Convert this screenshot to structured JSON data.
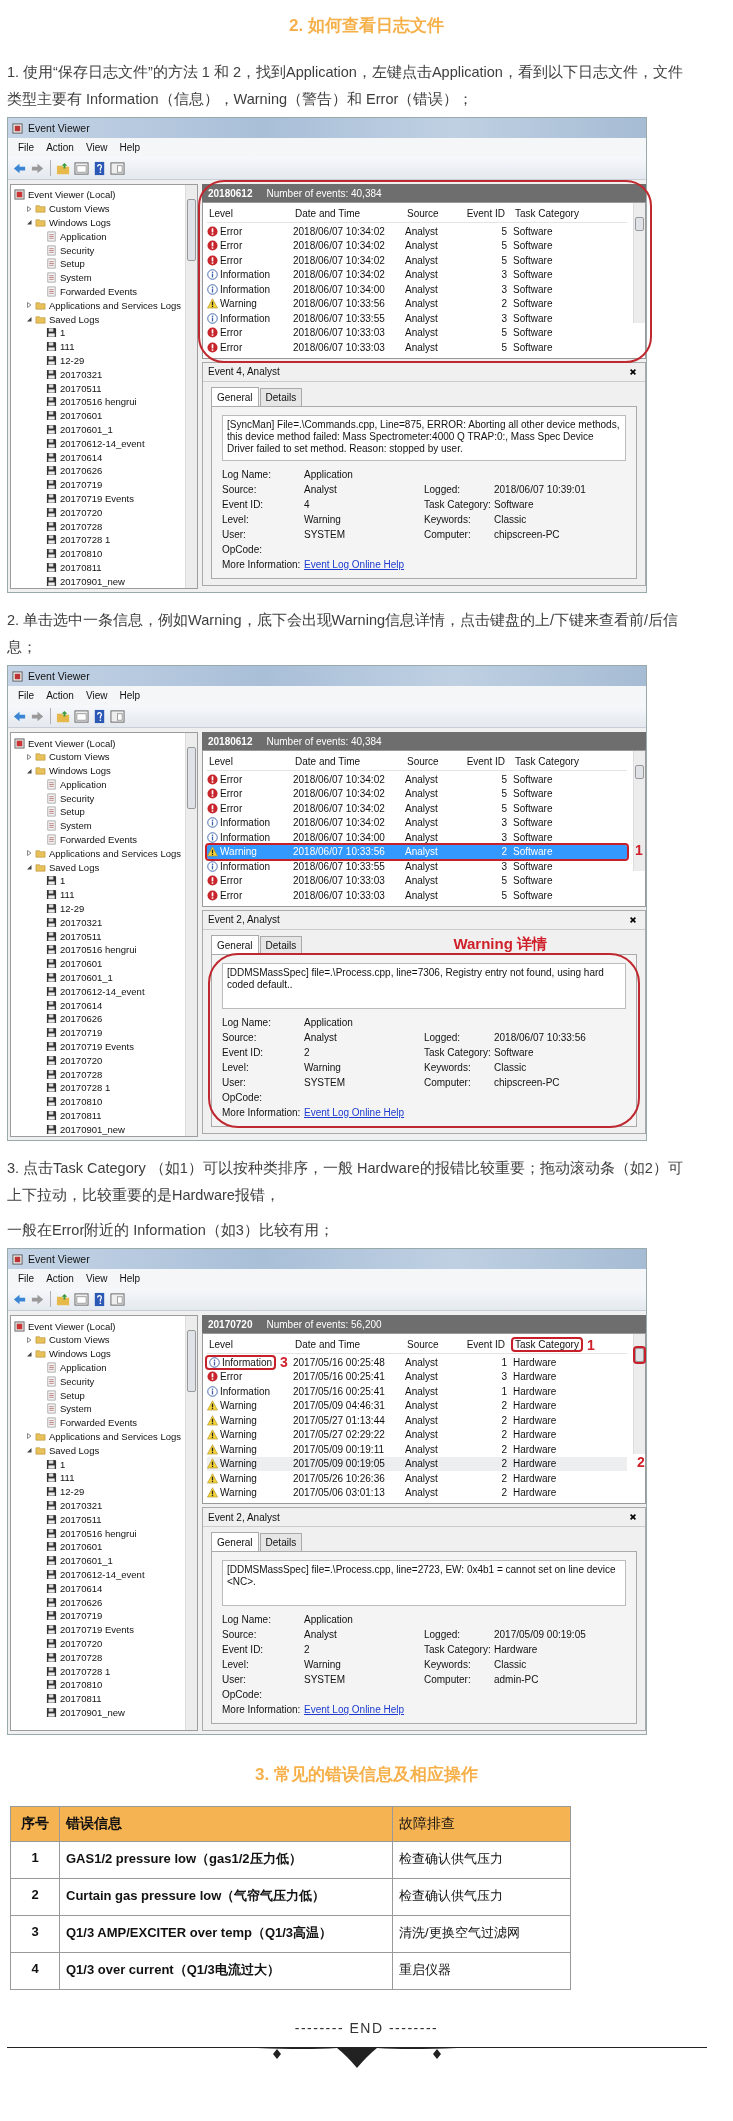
{
  "content": [
    {
      "kind": "heading",
      "text": "2. 如何查看日志文件"
    },
    {
      "kind": "paragraph",
      "text": "1. 使用“保存日志文件”的方法 1 和 2，找到Application，左键点击Application，看到以下日志文件，文件类型主要有 Information（信息），Warning（警告）和 Error（错误）；"
    },
    {
      "kind": "screenshot",
      "title": "Event Viewer",
      "menu": [
        "File",
        "Action",
        "View",
        "Help"
      ],
      "tree": [
        {
          "label": "Event Viewer (Local)",
          "kind": "viewer",
          "children": [
            {
              "label": "Custom Views",
              "kind": "folder",
              "expanded": false
            },
            {
              "label": "Windows Logs",
              "kind": "folder",
              "expanded": true,
              "children": [
                {
                  "label": "Application",
                  "kind": "log"
                },
                {
                  "label": "Security",
                  "kind": "log"
                },
                {
                  "label": "Setup",
                  "kind": "log"
                },
                {
                  "label": "System",
                  "kind": "log"
                },
                {
                  "label": "Forwarded Events",
                  "kind": "log"
                }
              ]
            },
            {
              "label": "Applications and Services Logs",
              "kind": "folder",
              "expanded": false
            },
            {
              "label": "Saved Logs",
              "kind": "folder",
              "expanded": true,
              "children": [
                {
                  "label": "1",
                  "kind": "saved"
                },
                {
                  "label": "111",
                  "kind": "saved"
                },
                {
                  "label": "12-29",
                  "kind": "saved"
                },
                {
                  "label": "20170321",
                  "kind": "saved"
                },
                {
                  "label": "20170511",
                  "kind": "saved"
                },
                {
                  "label": "20170516 hengrui",
                  "kind": "saved"
                },
                {
                  "label": "20170601",
                  "kind": "saved"
                },
                {
                  "label": "20170601_1",
                  "kind": "saved"
                },
                {
                  "label": "20170612-14_event",
                  "kind": "saved"
                },
                {
                  "label": "20170614",
                  "kind": "saved"
                },
                {
                  "label": "20170626",
                  "kind": "saved"
                },
                {
                  "label": "20170719",
                  "kind": "saved"
                },
                {
                  "label": "20170719 Events",
                  "kind": "saved"
                },
                {
                  "label": "20170720",
                  "kind": "saved"
                },
                {
                  "label": "20170728",
                  "kind": "saved"
                },
                {
                  "label": "20170728 1",
                  "kind": "saved"
                },
                {
                  "label": "20170810",
                  "kind": "saved"
                },
                {
                  "label": "20170811",
                  "kind": "saved"
                },
                {
                  "label": "20170901_new",
                  "kind": "saved"
                }
              ]
            }
          ]
        }
      ],
      "log_name": "20180612",
      "event_count": "Number of events: 40,384",
      "list_circled": true,
      "columns": [
        {
          "label": "Level"
        },
        {
          "label": "Date and Time"
        },
        {
          "label": "Source"
        },
        {
          "label": "Event ID"
        },
        {
          "label": "Task Category"
        }
      ],
      "rows": [
        {
          "kind": "error",
          "level": "Error",
          "date": "2018/06/07 10:34:02",
          "source": "Analyst",
          "event_id": "5",
          "category": "Software",
          "selected": false
        },
        {
          "kind": "error",
          "level": "Error",
          "date": "2018/06/07 10:34:02",
          "source": "Analyst",
          "event_id": "5",
          "category": "Software",
          "selected": false
        },
        {
          "kind": "error",
          "level": "Error",
          "date": "2018/06/07 10:34:02",
          "source": "Analyst",
          "event_id": "5",
          "category": "Software",
          "selected": false
        },
        {
          "kind": "information",
          "level": "Information",
          "date": "2018/06/07 10:34:02",
          "source": "Analyst",
          "event_id": "3",
          "category": "Software",
          "selected": false
        },
        {
          "kind": "information",
          "level": "Information",
          "date": "2018/06/07 10:34:00",
          "source": "Analyst",
          "event_id": "3",
          "category": "Software",
          "selected": false
        },
        {
          "kind": "warning",
          "level": "Warning",
          "date": "2018/06/07 10:33:56",
          "source": "Analyst",
          "event_id": "2",
          "category": "Software",
          "selected": false
        },
        {
          "kind": "information",
          "level": "Information",
          "date": "2018/06/07 10:33:55",
          "source": "Analyst",
          "event_id": "3",
          "category": "Software",
          "selected": false
        },
        {
          "kind": "error",
          "level": "Error",
          "date": "2018/06/07 10:33:03",
          "source": "Analyst",
          "event_id": "5",
          "category": "Software",
          "selected": false
        },
        {
          "kind": "error",
          "level": "Error",
          "date": "2018/06/07 10:33:03",
          "source": "Analyst",
          "event_id": "5",
          "category": "Software",
          "selected": false
        }
      ],
      "details": {
        "title": "Event 4, Analyst",
        "tabs": [
          {
            "label": "General",
            "selected": true
          },
          {
            "label": "Details",
            "selected": false
          }
        ],
        "message": "[SyncMan] File=.\\Commands.cpp, Line=875, ERROR: Aborting all other device methods, this device method failed: Mass Spectrometer:4000 Q TRAP:0:, Mass Spec Device Driver failed to set method.  Reason:  stopped by user.",
        "properties": [
          {
            "label": "Log Name:",
            "value": "Application"
          },
          {
            "label": "Source:",
            "value": "Analyst",
            "label2": "Logged:",
            "value2": "2018/06/07 10:39:01"
          },
          {
            "label": "Event ID:",
            "value": "4",
            "label2": "Task Category:",
            "value2": "Software"
          },
          {
            "label": "Level:",
            "value": "Warning",
            "label2": "Keywords:",
            "value2": "Classic"
          },
          {
            "label": "User:",
            "value": "SYSTEM",
            "label2": "Computer:",
            "value2": "chipscreen-PC"
          },
          {
            "label": "OpCode:"
          },
          {
            "label": "More Information:",
            "link": "Event Log Online Help"
          }
        ]
      }
    },
    {
      "kind": "paragraph",
      "text": "2. 单击选中一条信息，例如Warning，底下会出现Warning信息详情，点击键盘的上/下键来查看前/后信息；"
    },
    {
      "kind": "screenshot",
      "title": "Event Viewer",
      "menu": [
        "File",
        "Action",
        "View",
        "Help"
      ],
      "tree": [
        {
          "label": "Event Viewer (Local)",
          "kind": "viewer",
          "children": [
            {
              "label": "Custom Views",
              "kind": "folder",
              "expanded": false
            },
            {
              "label": "Windows Logs",
              "kind": "folder",
              "expanded": true,
              "children": [
                {
                  "label": "Application",
                  "kind": "log"
                },
                {
                  "label": "Security",
                  "kind": "log"
                },
                {
                  "label": "Setup",
                  "kind": "log"
                },
                {
                  "label": "System",
                  "kind": "log"
                },
                {
                  "label": "Forwarded Events",
                  "kind": "log"
                }
              ]
            },
            {
              "label": "Applications and Services Logs",
              "kind": "folder",
              "expanded": false
            },
            {
              "label": "Saved Logs",
              "kind": "folder",
              "expanded": true,
              "children": [
                {
                  "label": "1",
                  "kind": "saved"
                },
                {
                  "label": "111",
                  "kind": "saved"
                },
                {
                  "label": "12-29",
                  "kind": "saved"
                },
                {
                  "label": "20170321",
                  "kind": "saved"
                },
                {
                  "label": "20170511",
                  "kind": "saved"
                },
                {
                  "label": "20170516 hengrui",
                  "kind": "saved"
                },
                {
                  "label": "20170601",
                  "kind": "saved"
                },
                {
                  "label": "20170601_1",
                  "kind": "saved"
                },
                {
                  "label": "20170612-14_event",
                  "kind": "saved"
                },
                {
                  "label": "20170614",
                  "kind": "saved"
                },
                {
                  "label": "20170626",
                  "kind": "saved"
                },
                {
                  "label": "20170719",
                  "kind": "saved"
                },
                {
                  "label": "20170719 Events",
                  "kind": "saved"
                },
                {
                  "label": "20170720",
                  "kind": "saved"
                },
                {
                  "label": "20170728",
                  "kind": "saved"
                },
                {
                  "label": "20170728 1",
                  "kind": "saved"
                },
                {
                  "label": "20170810",
                  "kind": "saved"
                },
                {
                  "label": "20170811",
                  "kind": "saved"
                },
                {
                  "label": "20170901_new",
                  "kind": "saved"
                }
              ]
            }
          ]
        }
      ],
      "log_name": "20180612",
      "event_count": "Number of events: 40,384",
      "list_focused": true,
      "columns": [
        {
          "label": "Level"
        },
        {
          "label": "Date and Time"
        },
        {
          "label": "Source"
        },
        {
          "label": "Event ID"
        },
        {
          "label": "Task Category"
        }
      ],
      "rows": [
        {
          "kind": "error",
          "level": "Error",
          "date": "2018/06/07 10:34:02",
          "source": "Analyst",
          "event_id": "5",
          "category": "Software",
          "selected": false
        },
        {
          "kind": "error",
          "level": "Error",
          "date": "2018/06/07 10:34:02",
          "source": "Analyst",
          "event_id": "5",
          "category": "Software",
          "selected": false
        },
        {
          "kind": "error",
          "level": "Error",
          "date": "2018/06/07 10:34:02",
          "source": "Analyst",
          "event_id": "5",
          "category": "Software",
          "selected": false
        },
        {
          "kind": "information",
          "level": "Information",
          "date": "2018/06/07 10:34:02",
          "source": "Analyst",
          "event_id": "3",
          "category": "Software",
          "selected": false
        },
        {
          "kind": "information",
          "level": "Information",
          "date": "2018/06/07 10:34:00",
          "source": "Analyst",
          "event_id": "3",
          "category": "Software",
          "selected": false
        },
        {
          "kind": "warning",
          "level": "Warning",
          "date": "2018/06/07 10:33:56",
          "source": "Analyst",
          "event_id": "2",
          "category": "Software",
          "selected": true,
          "callout": {
            "label": "1",
            "kind": "row"
          }
        },
        {
          "kind": "information",
          "level": "Information",
          "date": "2018/06/07 10:33:55",
          "source": "Analyst",
          "event_id": "3",
          "category": "Software",
          "selected": false
        },
        {
          "kind": "error",
          "level": "Error",
          "date": "2018/06/07 10:33:03",
          "source": "Analyst",
          "event_id": "5",
          "category": "Software",
          "selected": false
        },
        {
          "kind": "error",
          "level": "Error",
          "date": "2018/06/07 10:33:03",
          "source": "Analyst",
          "event_id": "5",
          "category": "Software",
          "selected": false
        }
      ],
      "details": {
        "title": "Event 2, Analyst",
        "circled": true,
        "callout_title": "Warning 详情",
        "tabs": [
          {
            "label": "General",
            "selected": true
          },
          {
            "label": "Details",
            "selected": false
          }
        ],
        "message": "[DDMSMassSpec] file=.\\Process.cpp, line=7306, Registry entry not found, using hard coded default..",
        "properties": [
          {
            "label": "Log Name:",
            "value": "Application"
          },
          {
            "label": "Source:",
            "value": "Analyst",
            "label2": "Logged:",
            "value2": "2018/06/07 10:33:56"
          },
          {
            "label": "Event ID:",
            "value": "2",
            "label2": "Task Category:",
            "value2": "Software"
          },
          {
            "label": "Level:",
            "value": "Warning",
            "label2": "Keywords:",
            "value2": "Classic"
          },
          {
            "label": "User:",
            "value": "SYSTEM",
            "label2": "Computer:",
            "value2": "chipscreen-PC"
          },
          {
            "label": "OpCode:"
          },
          {
            "label": "More Information:",
            "link": "Event Log Online Help"
          }
        ]
      }
    },
    {
      "kind": "paragraph",
      "text": "3. 点击Task Category （如1）可以按种类排序，一般 Hardware的报错比较重要；拖动滚动条（如2）可上下拉动，比较重要的是Hardware报错，"
    },
    {
      "kind": "paragraph",
      "text": "一般在Error附近的 Information（如3）比较有用；"
    },
    {
      "kind": "screenshot",
      "title": "Event Viewer",
      "menu": [
        "File",
        "Action",
        "View",
        "Help"
      ],
      "tree": [
        {
          "label": "Event Viewer (Local)",
          "kind": "viewer",
          "children": [
            {
              "label": "Custom Views",
              "kind": "folder",
              "expanded": false
            },
            {
              "label": "Windows Logs",
              "kind": "folder",
              "expanded": true,
              "children": [
                {
                  "label": "Application",
                  "kind": "log"
                },
                {
                  "label": "Security",
                  "kind": "log"
                },
                {
                  "label": "Setup",
                  "kind": "log"
                },
                {
                  "label": "System",
                  "kind": "log"
                },
                {
                  "label": "Forwarded Events",
                  "kind": "log"
                }
              ]
            },
            {
              "label": "Applications and Services Logs",
              "kind": "folder",
              "expanded": false
            },
            {
              "label": "Saved Logs",
              "kind": "folder",
              "expanded": true,
              "children": [
                {
                  "label": "1",
                  "kind": "saved"
                },
                {
                  "label": "111",
                  "kind": "saved"
                },
                {
                  "label": "12-29",
                  "kind": "saved"
                },
                {
                  "label": "20170321",
                  "kind": "saved"
                },
                {
                  "label": "20170511",
                  "kind": "saved"
                },
                {
                  "label": "20170516 hengrui",
                  "kind": "saved"
                },
                {
                  "label": "20170601",
                  "kind": "saved"
                },
                {
                  "label": "20170601_1",
                  "kind": "saved"
                },
                {
                  "label": "20170612-14_event",
                  "kind": "saved"
                },
                {
                  "label": "20170614",
                  "kind": "saved"
                },
                {
                  "label": "20170626",
                  "kind": "saved"
                },
                {
                  "label": "20170719",
                  "kind": "saved"
                },
                {
                  "label": "20170719 Events",
                  "kind": "saved"
                },
                {
                  "label": "20170720",
                  "kind": "saved"
                },
                {
                  "label": "20170728",
                  "kind": "saved"
                },
                {
                  "label": "20170728 1",
                  "kind": "saved"
                },
                {
                  "label": "20170810",
                  "kind": "saved"
                },
                {
                  "label": "20170811",
                  "kind": "saved"
                },
                {
                  "label": "20170901_new",
                  "kind": "saved"
                }
              ]
            }
          ]
        }
      ],
      "log_name": "20170720",
      "event_count": "Number of events: 56,200",
      "list_focused": false,
      "scrollbar_callout": "2",
      "columns": [
        {
          "label": "Level"
        },
        {
          "label": "Date and Time"
        },
        {
          "label": "Source"
        },
        {
          "label": "Event ID"
        },
        {
          "label": "Task Category",
          "callout": "1"
        }
      ],
      "rows": [
        {
          "kind": "information",
          "level": "Information",
          "date": "2017/05/16 00:25:48",
          "source": "Analyst",
          "event_id": "1",
          "category": "Hardware",
          "selected": false,
          "callout": {
            "label": "3",
            "kind": "level"
          }
        },
        {
          "kind": "error",
          "level": "Error",
          "date": "2017/05/16 00:25:41",
          "source": "Analyst",
          "event_id": "3",
          "category": "Hardware",
          "selected": false
        },
        {
          "kind": "information",
          "level": "Information",
          "date": "2017/05/16 00:25:41",
          "source": "Analyst",
          "event_id": "1",
          "category": "Hardware",
          "selected": false
        },
        {
          "kind": "warning",
          "level": "Warning",
          "date": "2017/05/09 04:46:31",
          "source": "Analyst",
          "event_id": "2",
          "category": "Hardware",
          "selected": false
        },
        {
          "kind": "warning",
          "level": "Warning",
          "date": "2017/05/27 01:13:44",
          "source": "Analyst",
          "event_id": "2",
          "category": "Hardware",
          "selected": false
        },
        {
          "kind": "warning",
          "level": "Warning",
          "date": "2017/05/27 02:29:22",
          "source": "Analyst",
          "event_id": "2",
          "category": "Hardware",
          "selected": false
        },
        {
          "kind": "warning",
          "level": "Warning",
          "date": "2017/05/09 00:19:11",
          "source": "Analyst",
          "event_id": "2",
          "category": "Hardware",
          "selected": false
        },
        {
          "kind": "warning",
          "level": "Warning",
          "date": "2017/05/09 00:19:05",
          "source": "Analyst",
          "event_id": "2",
          "category": "Hardware",
          "selected": true
        },
        {
          "kind": "warning",
          "level": "Warning",
          "date": "2017/05/26 10:26:36",
          "source": "Analyst",
          "event_id": "2",
          "category": "Hardware",
          "selected": false
        },
        {
          "kind": "warning",
          "level": "Warning",
          "date": "2017/05/06 03:01:13",
          "source": "Analyst",
          "event_id": "2",
          "category": "Hardware",
          "selected": false
        }
      ],
      "details": {
        "title": "Event 2, Analyst",
        "tabs": [
          {
            "label": "General",
            "selected": true
          },
          {
            "label": "Details",
            "selected": false
          }
        ],
        "message": "[DDMSMassSpec] file=.\\Process.cpp, line=2723, EW: 0x4b1 = cannot set on line device <NC>.",
        "properties": [
          {
            "label": "Log Name:",
            "value": "Application"
          },
          {
            "label": "Source:",
            "value": "Analyst",
            "label2": "Logged:",
            "value2": "2017/05/09 00:19:05"
          },
          {
            "label": "Event ID:",
            "value": "2",
            "label2": "Task Category:",
            "value2": "Hardware"
          },
          {
            "label": "Level:",
            "value": "Warning",
            "label2": "Keywords:",
            "value2": "Classic"
          },
          {
            "label": "User:",
            "value": "SYSTEM",
            "label2": "Computer:",
            "value2": "admin-PC"
          },
          {
            "label": "OpCode:"
          },
          {
            "label": "More Information:",
            "link": "Event Log Online Help"
          }
        ]
      }
    },
    {
      "kind": "heading",
      "text": "3. 常见的错误信息及相应操作"
    },
    {
      "kind": "table",
      "columns": [
        "序号",
        "错误信息",
        "故障排查"
      ],
      "rows": [
        [
          "1",
          "GAS1/2 pressure low（gas1/2压力低）",
          "检查确认供气压力"
        ],
        [
          "2",
          "Curtain gas pressure low（气帘气压力低）",
          "检查确认供气压力"
        ],
        [
          "3",
          "Q1/3 AMP/EXCITER over temp（Q1/3高温）",
          "清洗/更换空气过滤网"
        ],
        [
          "4",
          "Q1/3 over current（Q1/3电流过大）",
          "重启仪器"
        ]
      ]
    },
    {
      "kind": "end",
      "text": "-------- END --------"
    }
  ]
}
